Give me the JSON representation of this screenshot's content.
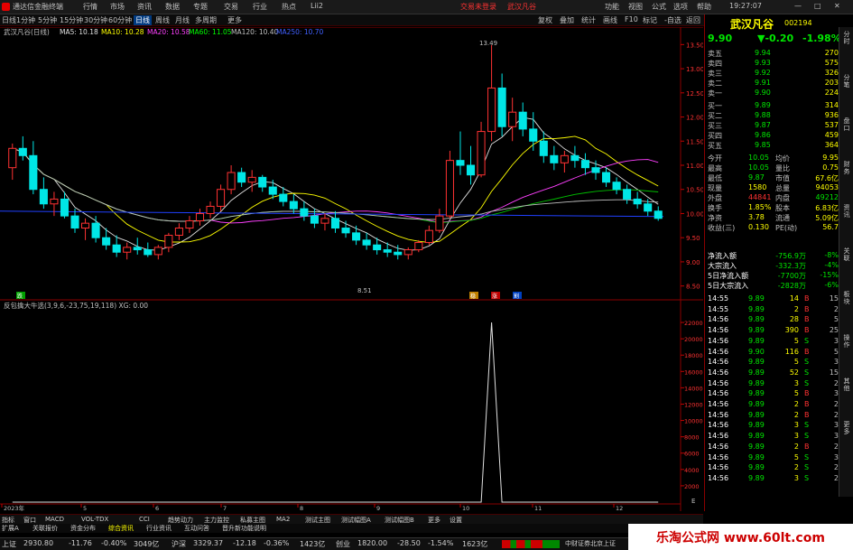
{
  "titlebar": {
    "app_title": "通达信金融终端",
    "menus": [
      "行情",
      "市场",
      "资讯",
      "数据",
      "专题",
      "交易",
      "行业",
      "热点",
      "Lii2"
    ],
    "trade_link": "交易未登录",
    "stock_link": "武汉凡谷",
    "right_menus": [
      "功能",
      "视图",
      "公式",
      "选项",
      "帮助"
    ],
    "clock": "19:27:07"
  },
  "periods": [
    "日线",
    "1分钟",
    "5分钟",
    "15分钟",
    "30分钟",
    "60分钟",
    "日线",
    "周线",
    "月线",
    "多周期",
    "更多"
  ],
  "period_right": [
    "复权",
    "叠加",
    "统计",
    "画线",
    "F10",
    "标记",
    "-自选",
    "返回"
  ],
  "stock": {
    "name": "武汉凡谷",
    "code": "002194",
    "price": "9.90",
    "change": "▼-0.20",
    "pct": "-1.98%"
  },
  "ma_legend": {
    "title": "武汉凡谷(日线)",
    "ma5": "MA5: 10.18",
    "ma10": "MA10: 10.28",
    "ma20": "MA20: 10.58",
    "ma60": "MA60: 11.05",
    "ma120": "MA120: 10.40",
    "ma250": "MA250: 10.70"
  },
  "price_axis": [
    "13.50",
    "13.00",
    "12.50",
    "12.00",
    "11.50",
    "11.00",
    "10.50",
    "10.00",
    "9.50",
    "9.00",
    "8.50"
  ],
  "annotations": {
    "high": "13.49",
    "low": "8.51"
  },
  "signals": [
    "跌",
    "稳",
    "涨",
    "割"
  ],
  "indicator": {
    "title": "反包擒大牛选(3,9,6,-23,75,19,118) XG: 0.00",
    "axis": [
      "22000",
      "20000",
      "18000",
      "16000",
      "14000",
      "12000",
      "10000",
      "8000",
      "6000",
      "4000",
      "2000"
    ],
    "unit": "E"
  },
  "date_axis": [
    "2023年",
    "5",
    "6",
    "7",
    "8",
    "9",
    "10",
    "11",
    "12"
  ],
  "order_book": {
    "sells": [
      {
        "label": "卖五",
        "price": "9.94",
        "vol": "270"
      },
      {
        "label": "卖四",
        "price": "9.93",
        "vol": "575"
      },
      {
        "label": "卖三",
        "price": "9.92",
        "vol": "326"
      },
      {
        "label": "卖二",
        "price": "9.91",
        "vol": "203"
      },
      {
        "label": "卖一",
        "price": "9.90",
        "vol": "224"
      }
    ],
    "buys": [
      {
        "label": "买一",
        "price": "9.89",
        "vol": "314"
      },
      {
        "label": "买二",
        "price": "9.88",
        "vol": "936"
      },
      {
        "label": "买三",
        "price": "9.87",
        "vol": "537"
      },
      {
        "label": "买四",
        "price": "9.86",
        "vol": "459"
      },
      {
        "label": "买五",
        "price": "9.85",
        "vol": "364"
      }
    ]
  },
  "quote": [
    {
      "l1": "今开",
      "v1": "10.05",
      "l2": "均价",
      "v2": "9.95"
    },
    {
      "l1": "最高",
      "v1": "10.05",
      "l2": "量比",
      "v2": "0.75"
    },
    {
      "l1": "最低",
      "v1": "9.87",
      "l2": "市值",
      "v2": "67.6亿"
    },
    {
      "l1": "现量",
      "v1": "1580",
      "l2": "总量",
      "v2": "94053"
    },
    {
      "l1": "外盘",
      "v1": "44841",
      "l2": "内盘",
      "v2": "49212"
    },
    {
      "l1": "换手",
      "v1": "1.85%",
      "l2": "股本",
      "v2": "6.83亿"
    },
    {
      "l1": "净资",
      "v1": "3.78",
      "l2": "流通",
      "v2": "5.09亿"
    },
    {
      "l1": "收益(三)",
      "v1": "0.130",
      "l2": "PE(动)",
      "v2": "56.7"
    }
  ],
  "flows": [
    {
      "label": "净流入额",
      "value": "-756.9万",
      "pct": "-8%"
    },
    {
      "label": "大宗流入",
      "value": "-332.3万",
      "pct": "-4%"
    },
    {
      "label": "5日净流入额",
      "value": "-7700万",
      "pct": "-15%"
    },
    {
      "label": "5日大宗流入",
      "value": "-2828万",
      "pct": "-6%"
    }
  ],
  "ticks": [
    {
      "t": "14:55",
      "p": "9.89",
      "v": "14",
      "bs": "B",
      "n": "15"
    },
    {
      "t": "14:55",
      "p": "9.89",
      "v": "2",
      "bs": "B",
      "n": "2"
    },
    {
      "t": "14:56",
      "p": "9.89",
      "v": "28",
      "bs": "B",
      "n": "5"
    },
    {
      "t": "14:56",
      "p": "9.89",
      "v": "390",
      "bs": "B",
      "n": "25"
    },
    {
      "t": "14:56",
      "p": "9.89",
      "v": "5",
      "bs": "S",
      "n": "3"
    },
    {
      "t": "14:56",
      "p": "9.90",
      "v": "116",
      "bs": "B",
      "n": "5"
    },
    {
      "t": "14:56",
      "p": "9.89",
      "v": "5",
      "bs": "S",
      "n": "3"
    },
    {
      "t": "14:56",
      "p": "9.89",
      "v": "52",
      "bs": "S",
      "n": "15"
    },
    {
      "t": "14:56",
      "p": "9.89",
      "v": "3",
      "bs": "S",
      "n": "2"
    },
    {
      "t": "14:56",
      "p": "9.89",
      "v": "5",
      "bs": "B",
      "n": "3"
    },
    {
      "t": "14:56",
      "p": "9.89",
      "v": "2",
      "bs": "B",
      "n": "2"
    },
    {
      "t": "14:56",
      "p": "9.89",
      "v": "2",
      "bs": "B",
      "n": "2"
    },
    {
      "t": "14:56",
      "p": "9.89",
      "v": "3",
      "bs": "S",
      "n": "3"
    },
    {
      "t": "14:56",
      "p": "9.89",
      "v": "3",
      "bs": "S",
      "n": "3"
    },
    {
      "t": "14:56",
      "p": "9.89",
      "v": "2",
      "bs": "B",
      "n": "2"
    },
    {
      "t": "14:56",
      "p": "9.89",
      "v": "5",
      "bs": "S",
      "n": "3"
    },
    {
      "t": "14:56",
      "p": "9.89",
      "v": "2",
      "bs": "S",
      "n": "2"
    },
    {
      "t": "14:56",
      "p": "9.89",
      "v": "3",
      "bs": "S",
      "n": "2"
    }
  ],
  "bottom_tabs": [
    "指标",
    "窗口",
    "MACD",
    "VOL-TDX",
    "CCI",
    "趋势动力",
    "主力监控",
    "私募主图",
    "MA2",
    "测试主图",
    "测试幅图A",
    "测试幅图B",
    "更多",
    "设置"
  ],
  "tabs2": [
    "扩展A",
    "关联报价",
    "资金分布",
    "综合资讯",
    "行业资讯",
    "互动问答",
    "晋升新功能说明"
  ],
  "statusbar": {
    "sh_label": "上证",
    "sh_val": "2930.80",
    "sh_chg": "-11.76",
    "sh_pct": "-0.40%",
    "sh_amt": "3049亿",
    "hs_label": "沪深",
    "hs_val": "3329.37",
    "hs_chg": "-12.18",
    "hs_pct": "-0.36%",
    "hs_amt": "1423亿",
    "cy_label": "创业",
    "cy_val": "1820.00",
    "cy_chg": "-28.50",
    "cy_pct": "-1.54%",
    "cy_amt": "1623亿",
    "broker": "中财证券北京上证"
  },
  "watermark": "乐淘公式网 www.60lt.com",
  "sidetabs": [
    "分时",
    "分笔",
    "盘口",
    "财务",
    "资讯",
    "关联",
    "板块",
    "操作",
    "其他",
    "更多"
  ],
  "colors": {
    "up": "#ff3232",
    "down": "#00e6e6",
    "bg": "#000000",
    "border": "#8a0000"
  },
  "candles": [
    [
      10.95,
      11.45,
      10.7,
      11.35
    ],
    [
      11.35,
      11.6,
      11.1,
      11.2
    ],
    [
      11.2,
      11.5,
      10.4,
      10.5
    ],
    [
      10.5,
      10.75,
      10.1,
      10.2
    ],
    [
      10.2,
      10.45,
      9.95,
      10.3
    ],
    [
      10.3,
      10.45,
      9.9,
      9.95
    ],
    [
      9.95,
      10.1,
      9.6,
      9.7
    ],
    [
      9.7,
      9.9,
      9.45,
      9.8
    ],
    [
      9.8,
      9.95,
      9.4,
      9.5
    ],
    [
      9.5,
      9.7,
      9.25,
      9.35
    ],
    [
      9.35,
      9.55,
      9.1,
      9.2
    ],
    [
      9.2,
      9.4,
      9.05,
      9.3
    ],
    [
      9.3,
      9.5,
      9.15,
      9.25
    ],
    [
      9.25,
      9.4,
      9.1,
      9.15
    ],
    [
      9.15,
      9.35,
      9.05,
      9.3
    ],
    [
      9.3,
      9.6,
      9.2,
      9.55
    ],
    [
      9.55,
      9.8,
      9.45,
      9.7
    ],
    [
      9.7,
      9.95,
      9.6,
      9.85
    ],
    [
      9.85,
      10.1,
      9.75,
      10.0
    ],
    [
      10.0,
      10.25,
      9.9,
      10.15
    ],
    [
      10.15,
      10.6,
      10.05,
      10.5
    ],
    [
      10.5,
      11.0,
      10.4,
      10.85
    ],
    [
      10.85,
      10.95,
      10.55,
      10.65
    ],
    [
      10.65,
      10.9,
      10.45,
      10.75
    ],
    [
      10.75,
      10.8,
      10.45,
      10.55
    ],
    [
      10.55,
      10.7,
      10.3,
      10.4
    ],
    [
      10.4,
      10.55,
      10.15,
      10.25
    ],
    [
      10.25,
      10.4,
      10.0,
      10.1
    ],
    [
      10.1,
      10.25,
      9.85,
      9.95
    ],
    [
      9.95,
      10.1,
      9.7,
      9.8
    ],
    [
      9.8,
      10.0,
      9.65,
      9.9
    ],
    [
      9.9,
      10.05,
      9.6,
      9.7
    ],
    [
      9.7,
      9.85,
      9.5,
      9.6
    ],
    [
      9.6,
      9.75,
      9.35,
      9.45
    ],
    [
      9.45,
      9.6,
      9.25,
      9.35
    ],
    [
      9.35,
      9.5,
      9.15,
      9.25
    ],
    [
      9.25,
      9.4,
      9.1,
      9.2
    ],
    [
      9.2,
      9.35,
      9.05,
      9.15
    ],
    [
      9.15,
      9.3,
      9.05,
      9.25
    ],
    [
      9.25,
      9.45,
      9.2,
      9.4
    ],
    [
      9.4,
      9.75,
      9.35,
      9.65
    ],
    [
      9.65,
      10.1,
      9.6,
      9.95
    ],
    [
      9.95,
      11.3,
      9.9,
      11.1
    ],
    [
      11.1,
      11.7,
      10.8,
      11.0
    ],
    [
      11.0,
      11.4,
      10.6,
      10.8
    ],
    [
      10.8,
      11.9,
      10.75,
      11.7
    ],
    [
      11.7,
      13.49,
      11.5,
      12.6
    ],
    [
      12.6,
      12.9,
      11.6,
      11.8
    ],
    [
      11.8,
      12.4,
      11.5,
      12.1
    ],
    [
      12.1,
      12.3,
      11.6,
      11.75
    ],
    [
      11.75,
      12.1,
      11.3,
      11.5
    ],
    [
      11.5,
      11.7,
      11.05,
      11.2
    ],
    [
      11.2,
      11.4,
      10.9,
      11.05
    ],
    [
      11.05,
      11.3,
      10.85,
      11.2
    ],
    [
      11.2,
      11.4,
      10.95,
      11.1
    ],
    [
      11.1,
      11.25,
      10.8,
      10.95
    ],
    [
      10.95,
      11.1,
      10.7,
      10.85
    ],
    [
      10.85,
      10.95,
      10.55,
      10.65
    ],
    [
      10.65,
      10.75,
      10.4,
      10.5
    ],
    [
      10.5,
      10.6,
      10.2,
      10.3
    ],
    [
      10.3,
      10.45,
      10.1,
      10.2
    ],
    [
      10.2,
      10.3,
      9.95,
      10.05
    ],
    [
      10.05,
      10.15,
      9.85,
      9.9
    ]
  ],
  "indicator_spike": {
    "index": 46,
    "value": 22000
  }
}
